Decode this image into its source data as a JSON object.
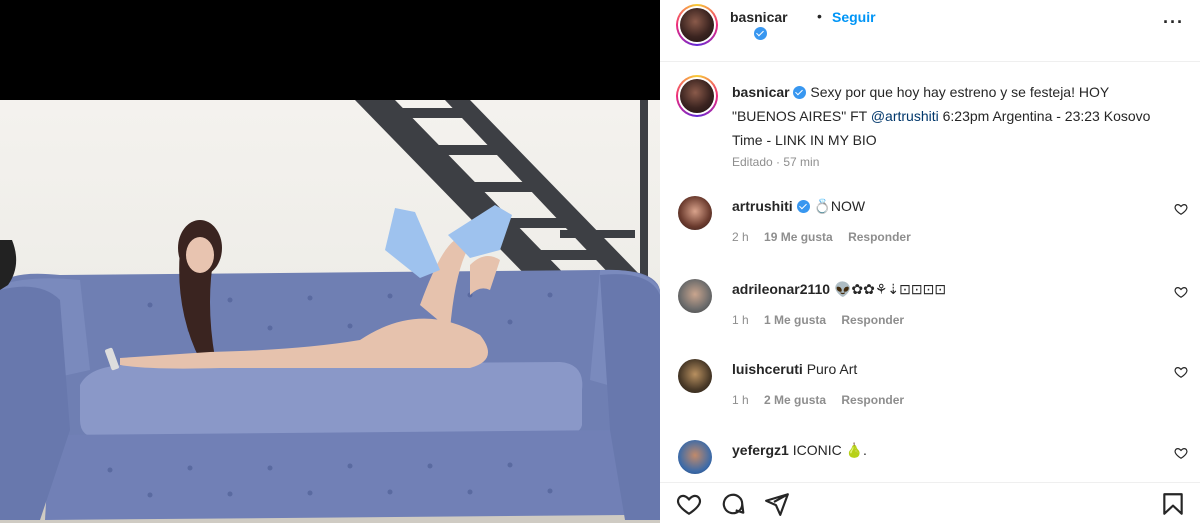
{
  "header": {
    "username": "basnicar",
    "separator": "•",
    "follow_label": "Seguir",
    "more_label": "···"
  },
  "caption": {
    "username": "basnicar",
    "text_before_mention": "Sexy por que hoy hay estreno y se festeja! HOY \"BUENOS AIRES\" FT ",
    "mention": "@artrushiti",
    "text_after_mention": " 6:23pm Argentina - 23:23 Kosovo Time - LINK IN MY BIO",
    "meta": "Editado · 57 min"
  },
  "comments": [
    {
      "username": "artrushiti",
      "verified": true,
      "text": "💍NOW",
      "time": "2 h",
      "likes": "19 Me gusta",
      "reply": "Responder"
    },
    {
      "username": "adrileonar2110",
      "verified": false,
      "text": "👽✿✿⚘⇣⊡⊡⊡⊡",
      "time": "1 h",
      "likes": "1 Me gusta",
      "reply": "Responder"
    },
    {
      "username": "luishceruti",
      "verified": false,
      "text": "Puro Art",
      "time": "1 h",
      "likes": "2 Me gusta",
      "reply": "Responder"
    },
    {
      "username": "yefergz1",
      "verified": false,
      "text": "ICONIC 🍐.",
      "time": "",
      "likes": "",
      "reply": ""
    }
  ],
  "colors": {
    "accent": "#0095f6",
    "sofa": "#6f7fb3",
    "verified": "#3897f0",
    "mention": "#00376b",
    "meta": "#8e8e8e"
  },
  "icons": [
    "heart-icon",
    "comment-icon",
    "share-icon",
    "save-icon",
    "verified-icon",
    "more-icon"
  ]
}
